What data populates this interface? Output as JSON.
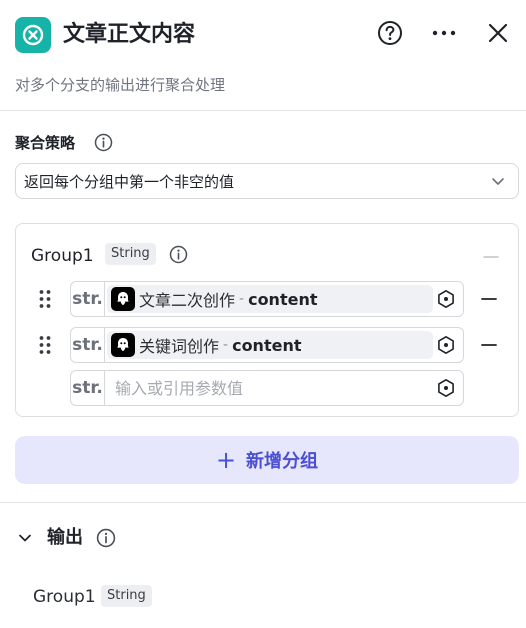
{
  "header": {
    "title": "文章正文内容",
    "subtitle": "对多个分支的输出进行聚合处理",
    "help_icon": "question-circle-icon",
    "more_icon": "more-horizontal-icon",
    "close_icon": "close-icon",
    "node_icon": "variable-merge-icon",
    "node_color": "#16b3a8"
  },
  "strategy": {
    "label": "聚合策略",
    "selected": "返回每个分组中第一个非空的值"
  },
  "group": {
    "name": "Group1",
    "type": "String",
    "items": [
      {
        "type_label": "str.",
        "node": "文章二次创作",
        "sep": "-",
        "var": "content"
      },
      {
        "type_label": "str.",
        "node": "关键词创作",
        "sep": "-",
        "var": "content"
      }
    ],
    "empty_field": {
      "type_label": "str.",
      "placeholder": "输入或引用参数值"
    }
  },
  "add_group": {
    "plus": "+",
    "label": "新增分组"
  },
  "output": {
    "label": "输出",
    "items": [
      {
        "name": "Group1",
        "type": "String"
      }
    ]
  },
  "colors": {
    "accent": "#4b4fd1",
    "add_button_bg": "#e6e7fd"
  }
}
